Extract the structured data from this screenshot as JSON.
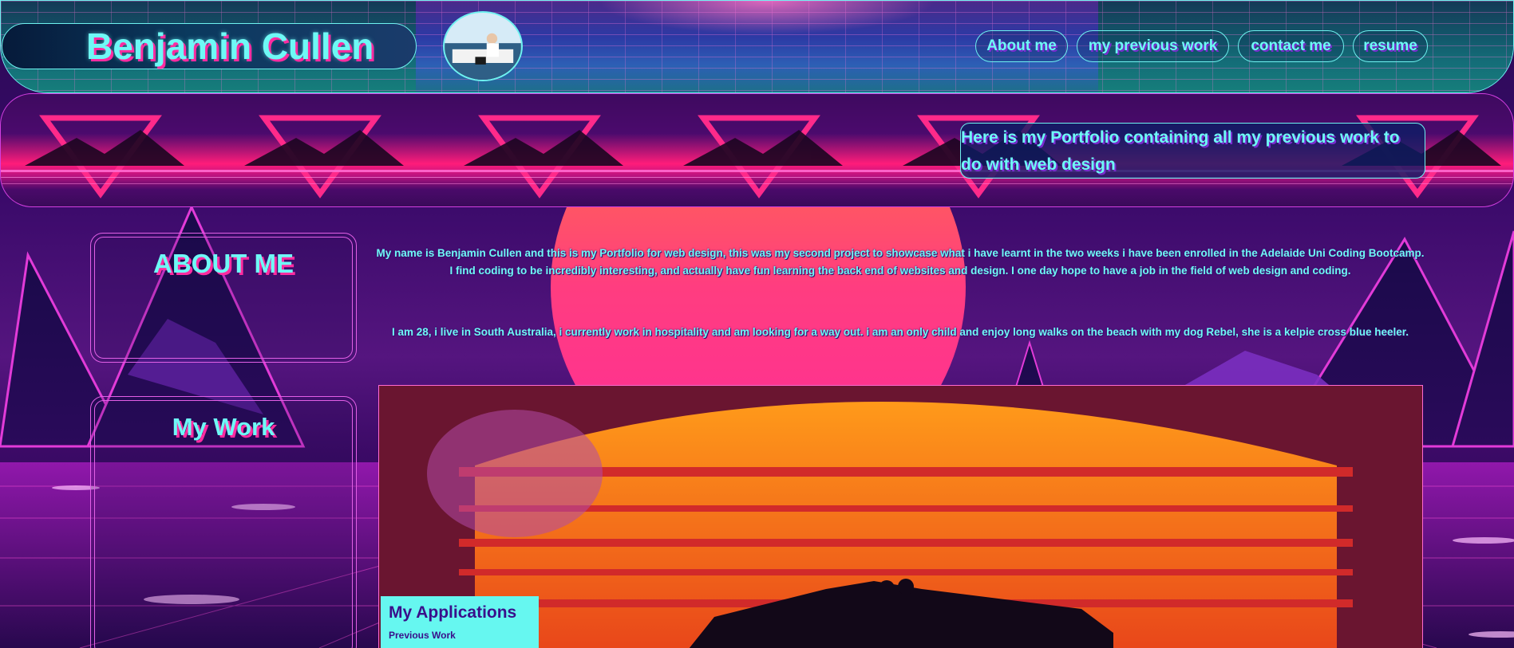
{
  "header": {
    "title": "Benjamin Cullen",
    "avatar_icon": "profile-photo",
    "nav": [
      {
        "label": "About me"
      },
      {
        "label": "my previous work"
      },
      {
        "label": "contact me"
      },
      {
        "label": "resume"
      }
    ]
  },
  "banner": {
    "tagline": "Here is my Portfolio containing all my previous work to do with web design"
  },
  "sidebar": {
    "about_title": "ABOUT ME",
    "work_title": "My Work"
  },
  "about": {
    "paragraph_1": "My name is Benjamin Cullen and this is my Portfolio for web design, this was my second project to showcase what i have learnt in the two weeks i have been enrolled in the Adelaide Uni Coding Bootcamp. I find coding to be incredibly interesting, and actually have fun learning the back end of websites and design. I one day hope to have a job in the field of web design and coding.",
    "paragraph_2": "I am 28, i live in South Australia, i currently work in hospitality and am looking for a way out. i am an only child and enjoy long walks on the beach with my dog Rebel, she is a kelpie cross blue heeler."
  },
  "work": {
    "card_title": "My Applications",
    "card_subtitle": "Previous Work",
    "image_icon": "synthwave-sunset-car-image"
  },
  "colors": {
    "accent_cyan": "#6ef9f6",
    "accent_pink": "#ff2ba0",
    "border_magenta": "#e25fe6",
    "card_bg": "#66f7f0",
    "card_text": "#3a0f8a"
  }
}
